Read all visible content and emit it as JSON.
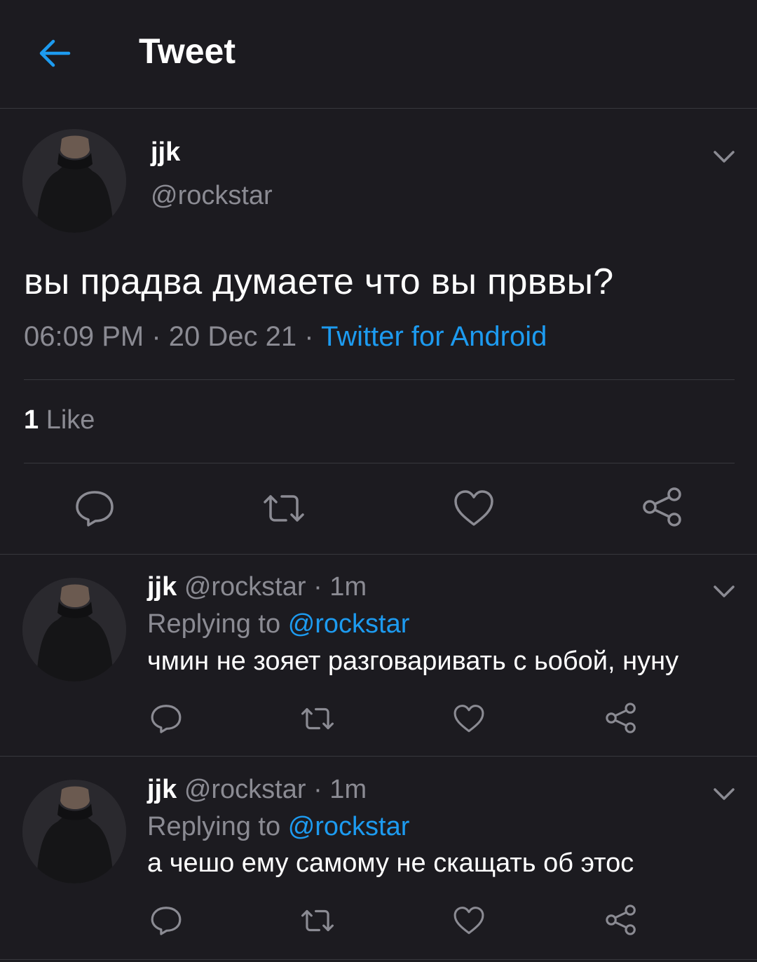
{
  "header": {
    "title": "Tweet",
    "back_icon": "arrow-left-icon",
    "accent": "#1d9bf0"
  },
  "tweet": {
    "name": "jjk",
    "handle": "@rockstar",
    "text": "вы прадва думаете что вы прввы?",
    "time": "06:09 PM",
    "date": "20 Dec 21",
    "separator": "·",
    "source": "Twitter for Android",
    "likes_count": "1",
    "likes_label": "Like",
    "actions": [
      "reply-icon",
      "retweet-icon",
      "like-icon",
      "share-icon"
    ]
  },
  "replies": [
    {
      "name": "jjk",
      "handle": "@rockstar",
      "time": "· 1m",
      "replying_label": "Replying to",
      "replying_to": "@rockstar",
      "text": "чмин не зояет разговаривать с ьобой, нуну"
    },
    {
      "name": "jjk",
      "handle": "@rockstar",
      "time": "· 1m",
      "replying_label": "Replying to",
      "replying_to": "@rockstar",
      "text": "а чешо ему самому не скащать об этос"
    }
  ]
}
